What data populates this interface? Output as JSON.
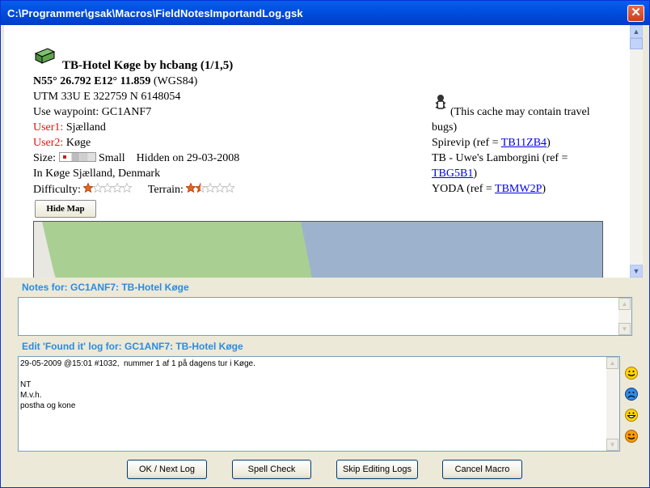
{
  "window": {
    "title": "C:\\Programmer\\gsak\\Macros\\FieldNotesImportandLog.gsk",
    "close_glyph": "✕"
  },
  "cache": {
    "heading": "TB-Hotel Køge by hcbang (1/1,5)",
    "coords": "N55° 26.792  E12° 11.859",
    "datum": " (WGS84)",
    "utm": "UTM  33U   E 322759  N 6148054",
    "waypoint": "Use waypoint: GC1ANF7",
    "user1_label": "User1:",
    "user1_value": " Sjælland",
    "user2_label": "User2:",
    "user2_value": " Køge",
    "size_label": "Size:",
    "size_value": "Small",
    "hidden": "Hidden on 29-03-2008",
    "location": "In Køge Sjælland, Denmark",
    "difficulty_label": "Difficulty:",
    "difficulty_rating": 1,
    "terrain_label": "Terrain:",
    "terrain_rating": 1.5,
    "max_rating": 5
  },
  "travel_bugs": {
    "note_line1": " (This cache may contain travel",
    "note_line2": "bugs)",
    "items": [
      {
        "prefix": "Spirevip (ref = ",
        "ref": "TB11ZB4",
        "suffix": ")"
      },
      {
        "prefix": "TB - Uwe's Lamborgini (ref =",
        "ref": "TBG5B1",
        "suffix": ")"
      },
      {
        "prefix": "YODA (ref = ",
        "ref": "TBMW2P",
        "suffix": ")"
      }
    ]
  },
  "hide_map_label": "Hide Map",
  "notes": {
    "label": "Notes for: GC1ANF7: TB-Hotel Køge",
    "value": ""
  },
  "log": {
    "label": "Edit 'Found it' log for: GC1ANF7: TB-Hotel Køge",
    "value": "29-05-2009 @15:01 #1032,  nummer 1 af 1 på dagens tur i Køge.\n\nNT\nM.v.h.\npostha og kone"
  },
  "buttons": {
    "ok": "OK / Next Log",
    "spell": "Spell Check",
    "skip": "Skip Editing Logs",
    "cancel": "Cancel Macro"
  },
  "colors": {
    "title_bar": "#0054E3",
    "section_label": "#2B8BE0",
    "user_label": "#E81010",
    "link": "#0000EE",
    "map_green": "#AACF93",
    "map_blue": "#9DB3CD"
  },
  "icons": [
    "cache-type-icon",
    "travel-bug-icon",
    "smile-icon",
    "sad-icon",
    "grin-icon",
    "wink-icon"
  ]
}
